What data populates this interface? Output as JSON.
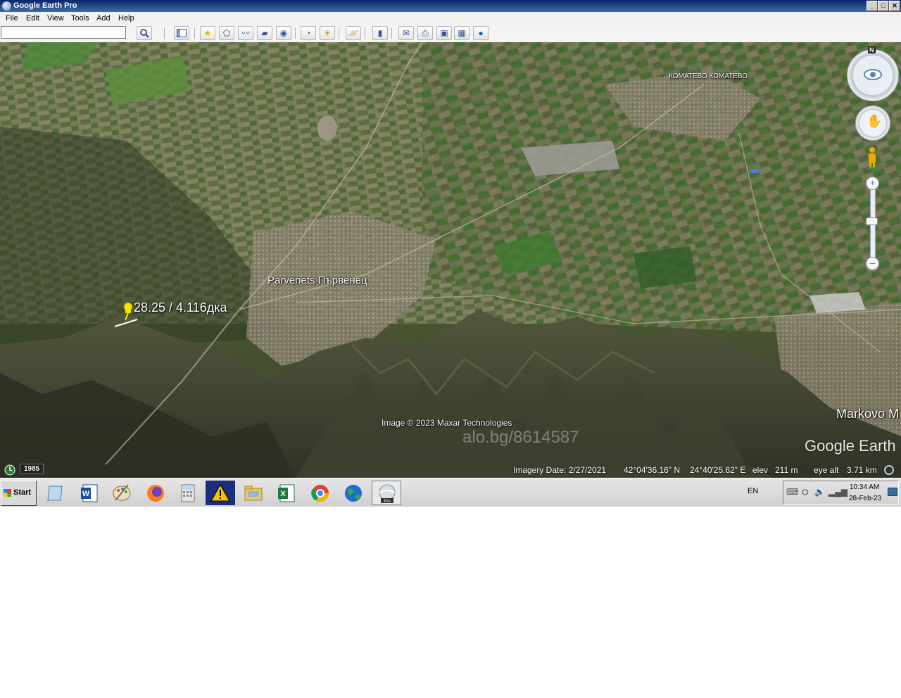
{
  "window": {
    "title": "Google Earth Pro",
    "buttons": {
      "minimize": "_",
      "maximize": "□",
      "close": "✕"
    }
  },
  "menu": [
    "File",
    "Edit",
    "View",
    "Tools",
    "Add",
    "Help"
  ],
  "search": {
    "value": "",
    "button_icon": "search-icon"
  },
  "toolbar": {
    "icons": [
      "sidebar-icon",
      "placemark-icon",
      "polygon-icon",
      "path-icon",
      "image-overlay-icon",
      "record-tour-icon",
      "historical-imagery-icon",
      "sunlight-icon",
      "planets-icon",
      "ruler-icon",
      "email-icon",
      "print-icon",
      "save-image-icon",
      "view-in-maps-icon",
      "sign-in-icon"
    ]
  },
  "map": {
    "labels": {
      "placemark": "28.25 / 4.116дка",
      "town": "Parvenets Първенец",
      "village_top": "КОМАТЕВО КОМАТЕВО",
      "town_right": "Markovo M",
      "copyright": "Image © 2023 Maxar Technologies",
      "watermark": "alo.bg/8614587",
      "logo": "Google Earth"
    },
    "compass_north": "N",
    "timeline_year": "1985"
  },
  "status": {
    "imagery_date": "Imagery Date: 2/27/2021",
    "lat": "42°04'36.16\" N",
    "lon": "24°40'25.62\" E",
    "elev_label": "elev",
    "elev_value": "211 m",
    "eye_alt_label": "eye alt",
    "eye_alt_value": "3.71 km"
  },
  "taskbar": {
    "start_label": "Start",
    "apps": [
      "show-desktop",
      "word",
      "paint",
      "firefox",
      "calculator",
      "warning",
      "file-explorer",
      "excel",
      "chrome",
      "earth-globe",
      "google-earth-pro"
    ],
    "active_app": "google-earth-pro",
    "lang": "EN",
    "time": "10:34 AM",
    "date": "28-Feb-23"
  }
}
